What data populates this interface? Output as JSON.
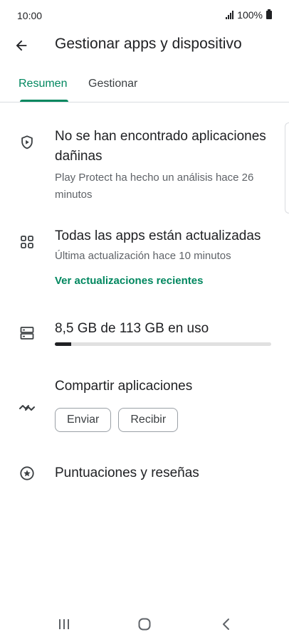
{
  "status_bar": {
    "time": "10:00",
    "battery": "100%"
  },
  "header": {
    "title": "Gestionar apps y dispositivo",
    "back_icon": "arrow-back-icon"
  },
  "tabs": [
    {
      "label": "Resumen",
      "active": true
    },
    {
      "label": "Gestionar",
      "active": false
    }
  ],
  "protect": {
    "icon": "shield-play-icon",
    "title": "No se han encontrado aplicaciones dañinas",
    "subtitle": "Play Protect ha hecho un análisis hace 26 minutos"
  },
  "updates": {
    "icon": "apps-grid-icon",
    "title": "Todas las apps están actualizadas",
    "subtitle": "Última actualización hace 10 minutos",
    "link": "Ver actualizaciones recientes"
  },
  "storage": {
    "icon": "storage-icon",
    "label": "8,5 GB de 113 GB en uso",
    "used_fraction": 0.075
  },
  "share": {
    "icon": "share-apps-icon",
    "title": "Compartir aplicaciones",
    "send_label": "Enviar",
    "receive_label": "Recibir"
  },
  "ratings": {
    "icon": "star-circle-icon",
    "title": "Puntuaciones y reseñas"
  },
  "colors": {
    "accent": "#01875f",
    "text_primary": "#202124",
    "text_secondary": "#5f6368"
  }
}
